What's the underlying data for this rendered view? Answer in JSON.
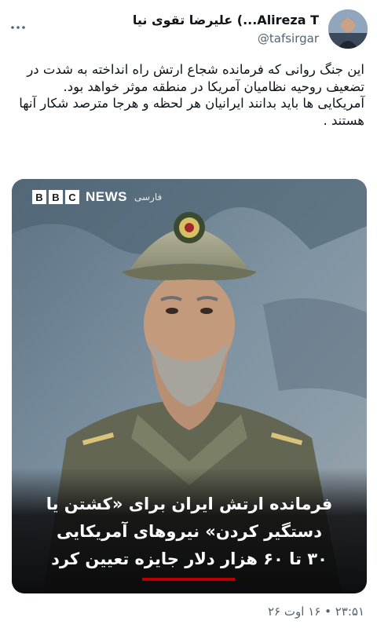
{
  "author": {
    "name": "علیرضا تقوی نیا (...Alireza T",
    "handle": "@tafsirgar"
  },
  "tweet": {
    "line1": "این جنگ روانی که فرمانده شجاع ارتش راه انداخته به شدت در تضعیف روحیه نظامیان آمریکا در منطقه موثر خواهد بود.",
    "line2": "آمریکایی ها باید بدانند ایرانیان هر لحظه و هرجا مترصد شکار آنها هستند ."
  },
  "media": {
    "logo_letters": [
      "B",
      "B",
      "C"
    ],
    "logo_news": "NEWS",
    "logo_farsi": "فارسی",
    "headline_1": "فرمانده ارتش ایران برای «کشتن یا",
    "headline_2": "دستگیر کردن» نیروهای آمریکایی",
    "headline_3": "۳۰ تا ۶۰ هزار دلار جایزه تعیین کرد"
  },
  "timestamp": "۲۳:۵۱ • ۱۶ اوت ۲۶",
  "icons": [
    "avatar",
    "more-icon",
    "bbc-news-logo"
  ],
  "colors": {
    "handle": "#536471",
    "accent_red": "#b80000"
  }
}
